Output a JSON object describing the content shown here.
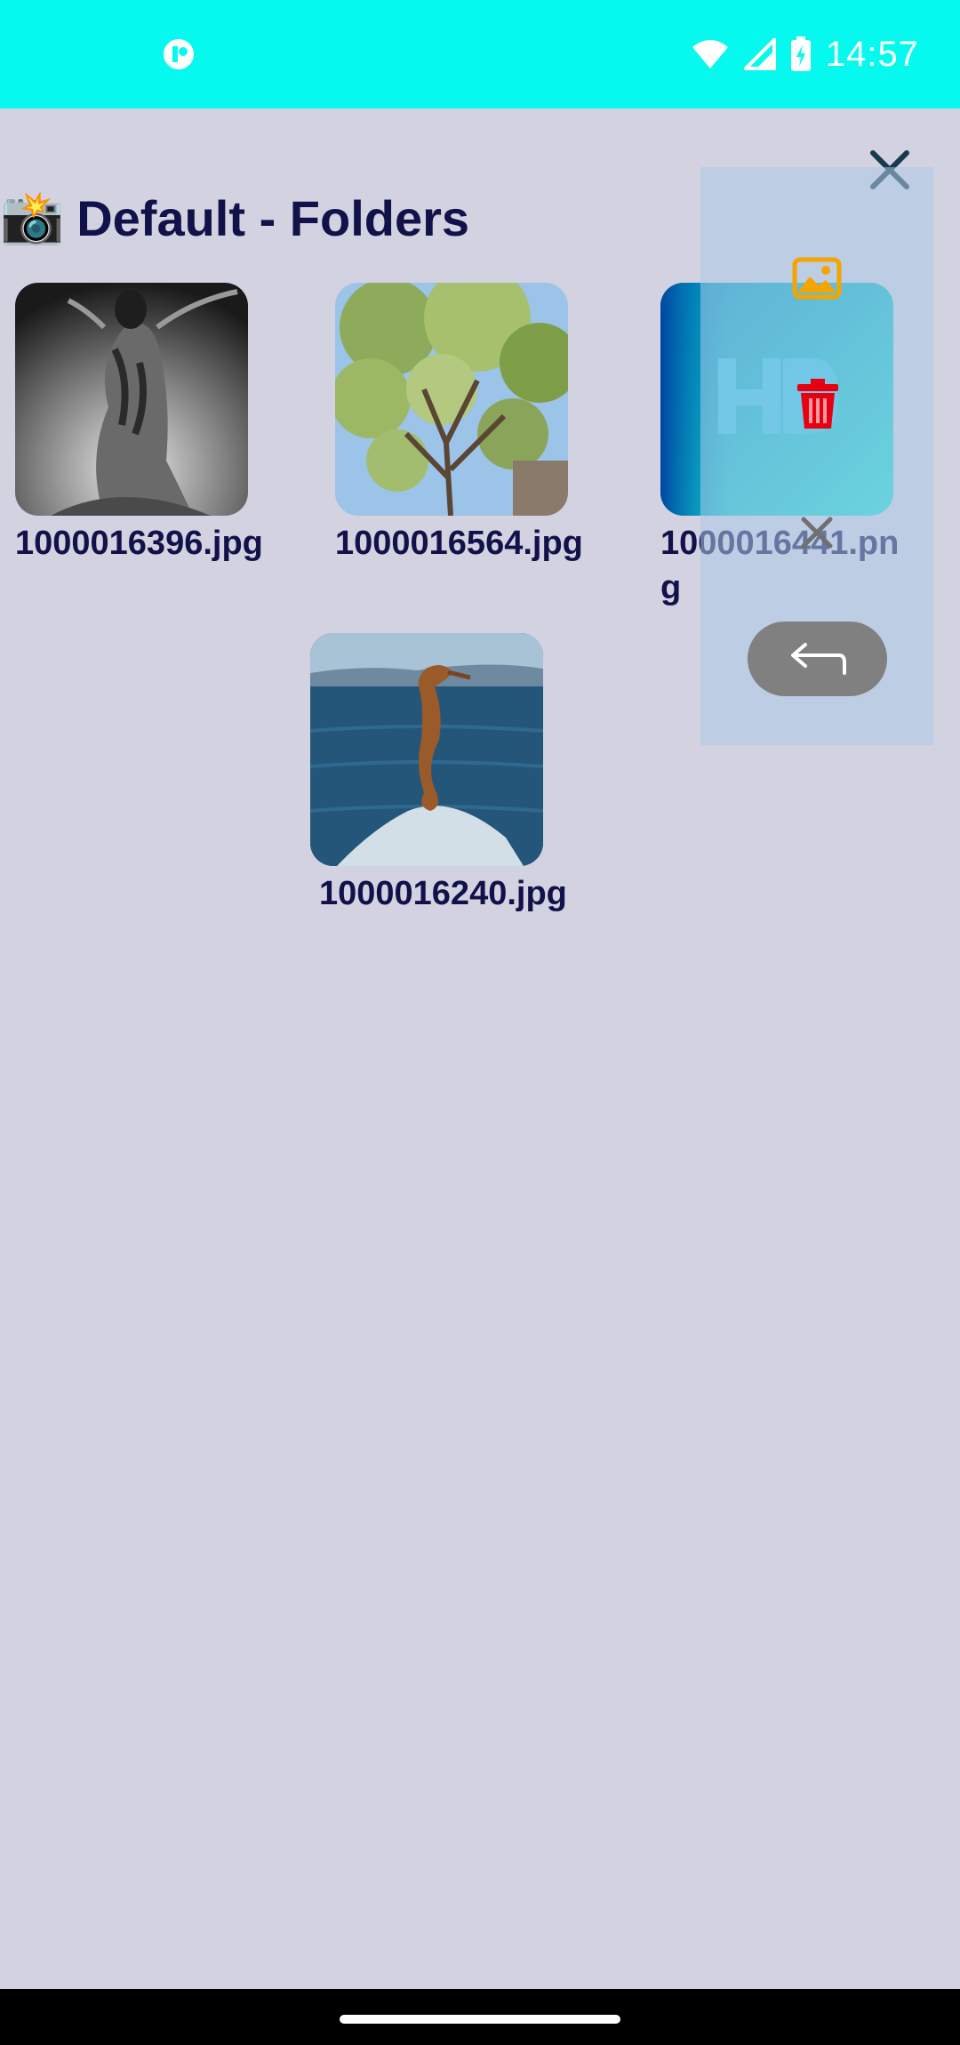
{
  "status_bar": {
    "time": "14:57",
    "icons": [
      "app-notification-icon",
      "wifi-icon",
      "signal-icon",
      "battery-charging-icon"
    ],
    "background": "#06f9ee"
  },
  "header": {
    "emoji": "📸",
    "title": "Default - Folders"
  },
  "files": [
    {
      "name": "1000016396.jpg",
      "display": " 1000016396.jpg",
      "thumb": "bw-tattoo-photo"
    },
    {
      "name": "1000016564.jpg",
      "display": " 1000016564.jpg",
      "thumb": "tree-branches-photo"
    },
    {
      "name": "1000016441.png",
      "display": " 1000016441.png",
      "thumb": "hd-logo-image"
    },
    {
      "name": "1000016240.jpg",
      "display": "1000016240.jpg",
      "thumb": "seahorse-photo"
    }
  ],
  "overlay": {
    "actions": [
      "image-icon",
      "trash-icon",
      "close-icon",
      "undo-icon"
    ],
    "colors": {
      "image_icon": "#f5a400",
      "trash_icon": "#e60012",
      "undo_button": "#808080"
    }
  },
  "colors": {
    "background": "#d2d2e0",
    "text": "#12124a"
  }
}
